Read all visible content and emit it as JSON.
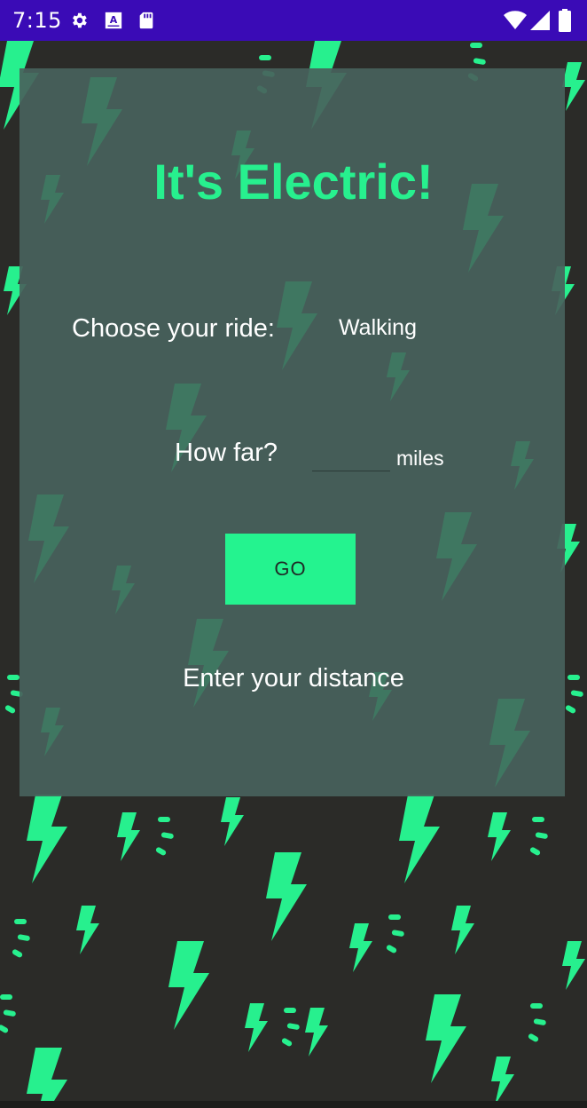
{
  "status_bar": {
    "time": "7:15",
    "icons": [
      "gear-icon",
      "a-notification-icon",
      "sd-card-icon",
      "wifi-icon",
      "signal-icon",
      "battery-icon"
    ]
  },
  "app": {
    "title": "It's Electric!",
    "ride_label": "Choose your ride:",
    "ride_selected": "Walking",
    "distance_label": "How far?",
    "distance_value": "",
    "distance_unit": "miles",
    "go_button": "GO",
    "result_text": "Enter your distance"
  },
  "colors": {
    "status_bar": "#3a0bb6",
    "accent_green": "#24f38f",
    "background": "#2b2b28",
    "card": "#48625c"
  }
}
